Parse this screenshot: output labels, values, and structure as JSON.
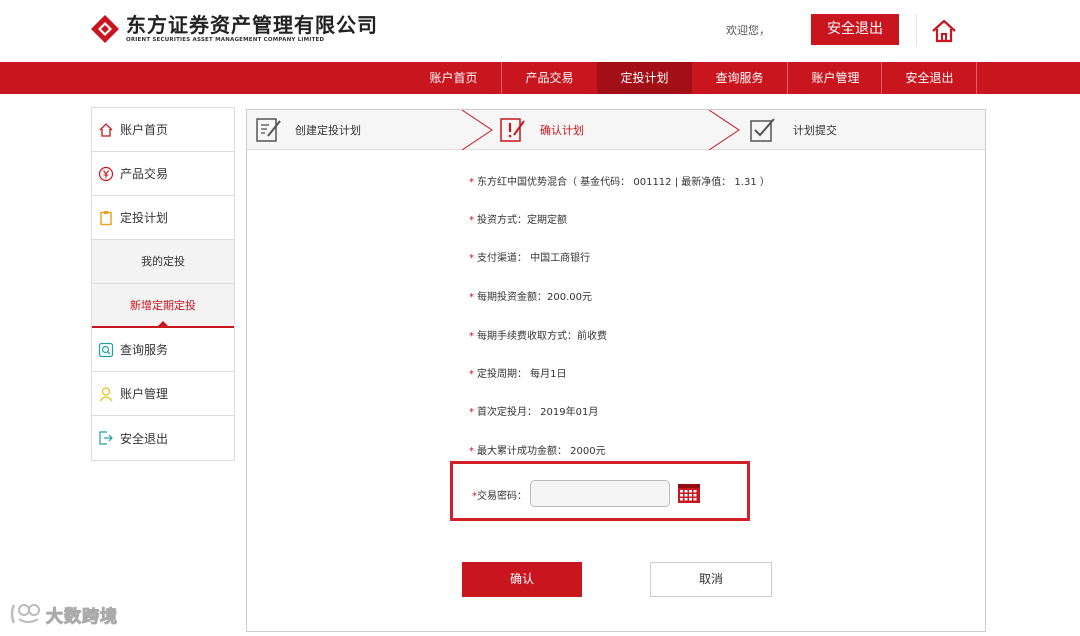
{
  "header": {
    "logo_cn": "东方证券资产管理有限公司",
    "logo_en": "ORIENT SECURITIES ASSET MANAGEMENT COMPANY LIMITED",
    "welcome": "欢迎您，",
    "logout_label": "安全退出"
  },
  "nav": {
    "items": [
      {
        "label": "账户首页"
      },
      {
        "label": "产品交易"
      },
      {
        "label": "定投计划"
      },
      {
        "label": "查询服务"
      },
      {
        "label": "账户管理"
      },
      {
        "label": "安全退出"
      }
    ]
  },
  "sidebar": {
    "items": [
      {
        "label": "账户首页",
        "icon": "home-icon"
      },
      {
        "label": "产品交易",
        "icon": "yen-icon"
      },
      {
        "label": "定投计划",
        "icon": "clipboard-icon"
      },
      {
        "label": "我的定投"
      },
      {
        "label": "新增定期定投"
      },
      {
        "label": "查询服务",
        "icon": "search-icon"
      },
      {
        "label": "账户管理",
        "icon": "user-icon"
      },
      {
        "label": "安全退出",
        "icon": "exit-icon"
      }
    ]
  },
  "steps": [
    {
      "label": "创建定投计划"
    },
    {
      "label": "确认计划"
    },
    {
      "label": "计划提交"
    }
  ],
  "info": [
    "东方红中国优势混合（ 基金代码： 001112 | 最新净值： 1.31 ）",
    "投资方式：定期定额",
    "支付渠道： 中国工商银行",
    "每期投资金额：200.00元",
    "每期手续费收取方式：前收费",
    "定投周期： 每月1日",
    "首次定投月： 2019年01月",
    "最大累计成功金额： 2000元"
  ],
  "password": {
    "star": "*",
    "label": "交易密码：",
    "value": ""
  },
  "buttons": {
    "confirm": "确认",
    "cancel": "取消"
  },
  "watermark": "大数跨境",
  "colors": {
    "brand_red": "#c9151e",
    "nav_active": "#a30f16",
    "highlight_border": "#d32128"
  }
}
